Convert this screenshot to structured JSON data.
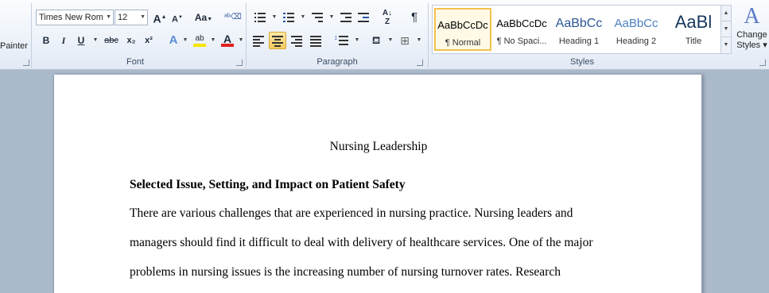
{
  "ribbon": {
    "clipboard": {
      "format_painter_label": "Painter"
    },
    "font": {
      "group_label": "Font",
      "font_name": "Times New Rom",
      "font_size": "12",
      "grow_label": "A",
      "shrink_label": "A",
      "change_case_label": "Aa",
      "bold": "B",
      "italic": "I",
      "underline": "U",
      "strike": "abc",
      "subscript": "x₂",
      "superscript": "x²",
      "font_color": "A",
      "highlight": "ab"
    },
    "paragraph": {
      "group_label": "Paragraph",
      "show_marks": "¶"
    },
    "styles": {
      "group_label": "Styles",
      "items": [
        {
          "sample": "AaBbCcDc",
          "name": "¶ Normal"
        },
        {
          "sample": "AaBbCcDc",
          "name": "¶ No Spaci..."
        },
        {
          "sample": "AaBbCc",
          "name": "Heading 1"
        },
        {
          "sample": "AaBbCc",
          "name": "Heading 2"
        },
        {
          "sample": "AaBl",
          "name": "Title"
        }
      ],
      "change_styles_line1": "Change",
      "change_styles_line2": "Styles ▾"
    }
  },
  "document": {
    "title": "Nursing Leadership",
    "heading": "Selected Issue, Setting, and Impact on Patient Safety",
    "lines": [
      "There are various challenges that are experienced in nursing practice. Nursing leaders and",
      "managers should find it difficult to deal with delivery of healthcare services.  One of the major",
      "problems in nursing issues is the increasing number of nursing turnover rates.  Research"
    ]
  },
  "colors": {
    "accent_selected": "#f2c14e",
    "font_color_bar": "#e02020",
    "highlight_bar": "#f5e600"
  }
}
